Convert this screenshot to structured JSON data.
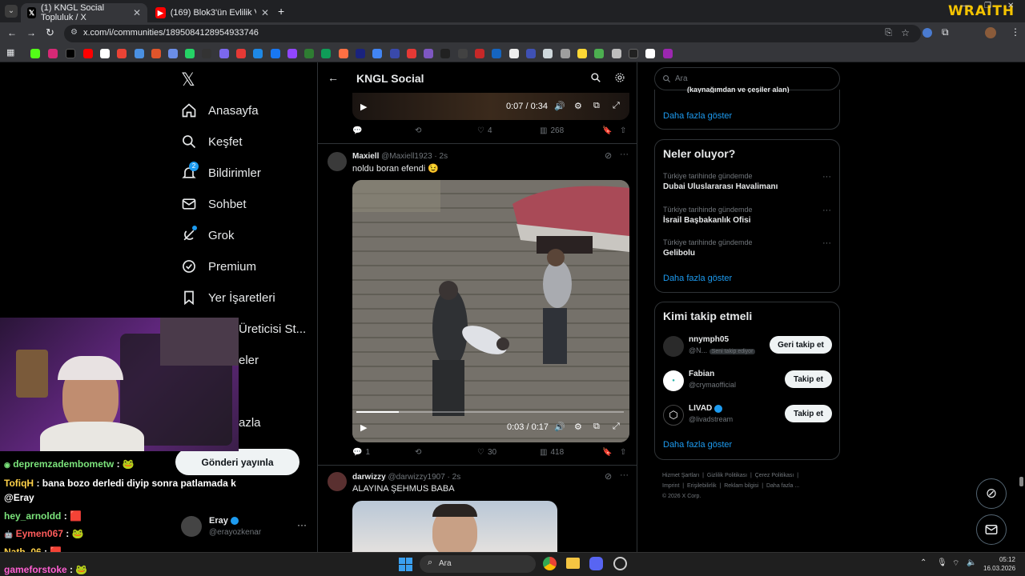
{
  "browser": {
    "tabs": [
      {
        "title": "(1) KNGL Social Topluluk / X",
        "active": true
      },
      {
        "title": "(169) Blok3'ün Evlilik Ve Çocuk",
        "active": false
      }
    ],
    "url": "x.com/i/communities/1895084128954933746",
    "branding": "WRAITH"
  },
  "nav": {
    "items": [
      {
        "label": "Anasayfa",
        "icon": "home-icon"
      },
      {
        "label": "Keşfet",
        "icon": "search-icon"
      },
      {
        "label": "Bildirimler",
        "icon": "bell-icon",
        "badge": "2"
      },
      {
        "label": "Sohbet",
        "icon": "mail-icon"
      },
      {
        "label": "Grok",
        "icon": "grok-icon"
      },
      {
        "label": "Premium",
        "icon": "premium-icon"
      },
      {
        "label": "Yer İşaretleri",
        "icon": "bookmark-icon"
      },
      {
        "label": "Üreticisi St..."
      },
      {
        "label": "eler"
      },
      {
        "label": "azla"
      }
    ],
    "post_button": "Gönderi yayınla",
    "account": {
      "name": "Eray",
      "handle": "@erayozkenar"
    }
  },
  "header": {
    "title": "KNGL Social"
  },
  "posts": [
    {
      "video_time": "0:07 / 0:34",
      "replies": "",
      "likes": "4",
      "views": "268"
    },
    {
      "name": "Maxiell",
      "handle": "@Maxiell1923 · 2s",
      "text": "noldu boran efendi 😉",
      "video_time": "0:03 / 0:17",
      "progress": 0.16,
      "replies": "1",
      "likes": "30",
      "views": "418"
    },
    {
      "name": "darwizzy",
      "handle": "@darwizzy1907 · 2s",
      "text": "ALAYINA ŞEHMUS BABA"
    }
  ],
  "search": {
    "placeholder": "Ara"
  },
  "right": {
    "partial_text": "(kaynağımdan ve çeşiler alan)",
    "show_more": "Daha fazla göster",
    "trends_title": "Neler oluyor?",
    "trends": [
      {
        "context": "Türkiye tarihinde gündemde",
        "name": "Dubai Uluslararası Havalimanı"
      },
      {
        "context": "Türkiye tarihinde gündemde",
        "name": "İsrail Başbakanlık Ofisi"
      },
      {
        "context": "Türkiye tarihinde gündemde",
        "name": "Gelibolu"
      }
    ],
    "who_title": "Kimi takip etmeli",
    "who": [
      {
        "name": "nnymph05",
        "handle": "@N...",
        "tag": "Seni takip ediyor",
        "button": "Geri takip et"
      },
      {
        "name": "Fabian",
        "handle": "@crymaofficial",
        "tag": "",
        "button": "Takip et"
      },
      {
        "name": "LIVAD",
        "handle": "@livadstream",
        "tag": "",
        "button": "Takip et"
      }
    ],
    "footer": [
      "Hizmet Şartları",
      "Gizlilik Politikası",
      "Çerez Politikası",
      "Imprint",
      "Erişilebilirlik",
      "Reklam bilgisi",
      "Daha fazla ...",
      "© 2026 X Corp."
    ]
  },
  "chat": [
    {
      "user": "depremzadembometw",
      "msg": " : 🐸",
      "color": "#7be37b"
    },
    {
      "user": "TofiqH",
      "msg": " : bana bozo derledi diyip sonra patlamada k",
      "color": "#ffd24a"
    },
    {
      "user": "",
      "msg": "@Eray",
      "color": "#ffffff"
    },
    {
      "user": "hey_arnoldd",
      "msg": " : 🟥",
      "color": "#7be37b"
    },
    {
      "user": "Eymen067",
      "msg": " : 🐸",
      "color": "#ff5b5b"
    },
    {
      "user": "Nath_06",
      "msg": " : 🟥",
      "color": "#ffd24a"
    },
    {
      "user": "gameforstoke",
      "msg": " : 🐸",
      "color": "#ff5fd2"
    }
  ],
  "taskbar": {
    "search": "Ara",
    "time": "05:12",
    "date": "16.03.2026"
  }
}
